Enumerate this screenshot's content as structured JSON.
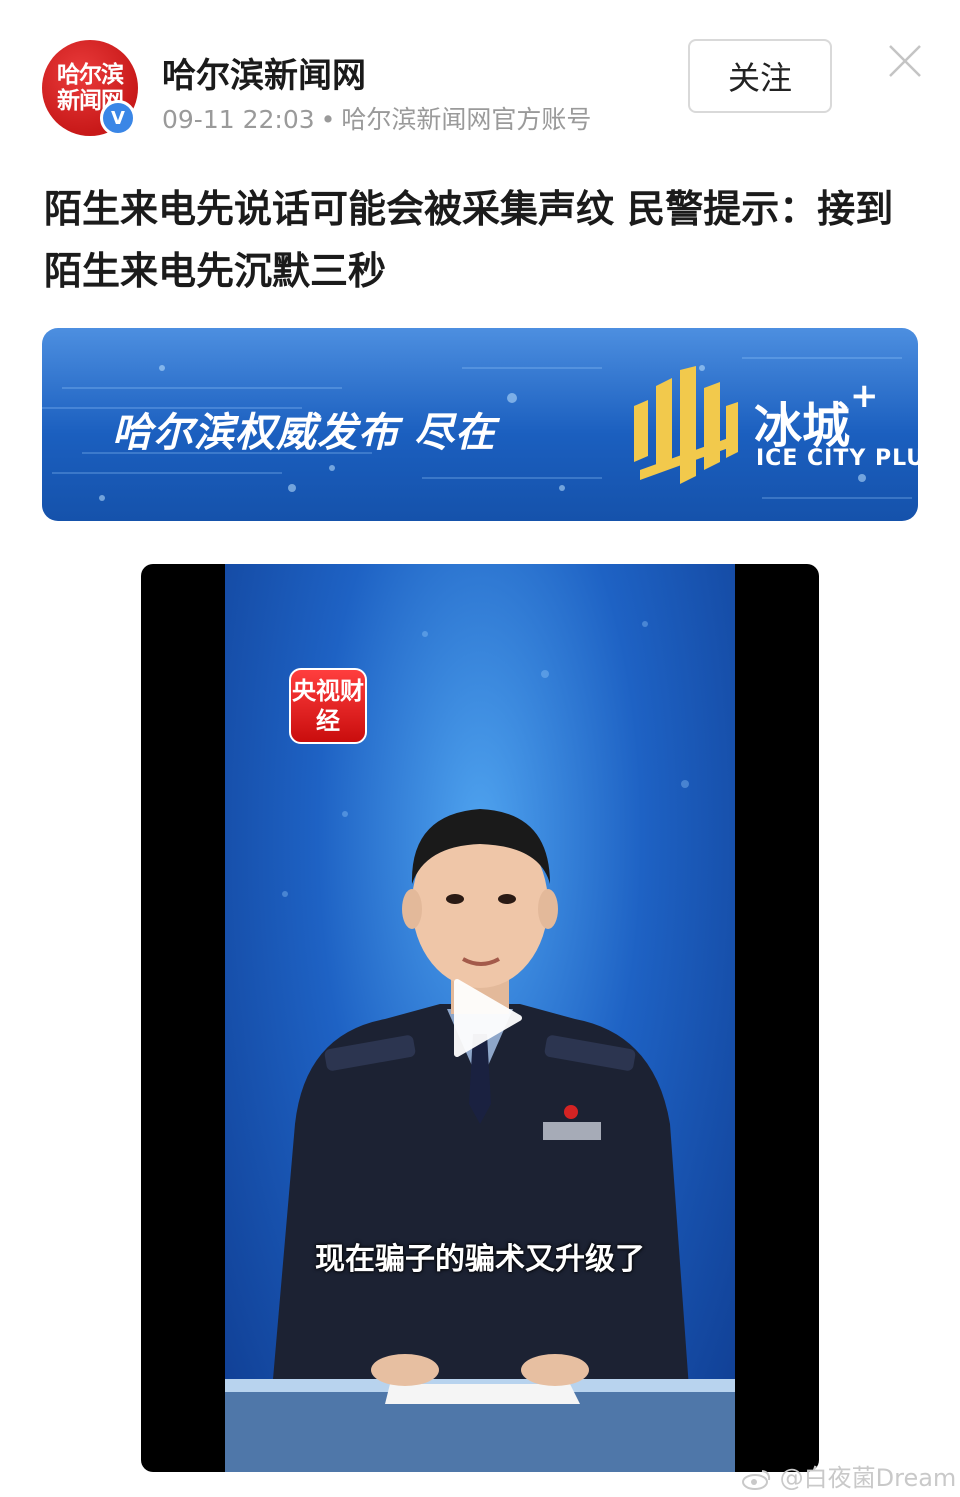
{
  "header": {
    "avatar_text": "哈尔滨新闻网",
    "verified_mark": "V",
    "account_name": "哈尔滨新闻网",
    "time": "09-11 22:03",
    "separator": "•",
    "source": "哈尔滨新闻网官方账号",
    "follow_label": "关注",
    "close_icon": "close-icon"
  },
  "post": {
    "title": "陌生来电先说话可能会被采集声纹 民警提示：接到陌生来电先沉默三秒"
  },
  "banner": {
    "slogan": "哈尔滨权威发布 尽在",
    "brand": "冰城",
    "brand_plus": "+",
    "brand_sub": "ICE CITY PLUS"
  },
  "video": {
    "badge": "央视财经",
    "caption": "现在骗子的骗术又升级了",
    "play_icon": "play-icon"
  },
  "watermark": {
    "text": "@白夜菌Dream"
  },
  "colors": {
    "avatar_red": "#d42323",
    "verified_blue": "#3a86e6",
    "banner_blue": "#1b5fbf",
    "logo_gold": "#f2c94c"
  }
}
